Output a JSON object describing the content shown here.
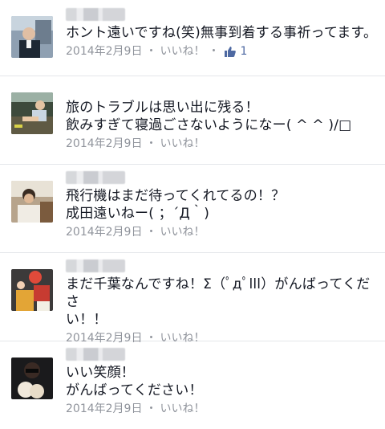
{
  "comments": [
    {
      "text": "ホント遠いですね(笑)無事到着する事祈ってます。",
      "date": "2014年2月9日",
      "like_label": "いいね！",
      "like_count": "1"
    },
    {
      "text": "旅のトラブルは思い出に残る！\n飲みすぎて寝過ごさないようになー( ^ ^ )/□",
      "date": "2014年2月9日",
      "like_label": "いいね！"
    },
    {
      "text": "飛行機はまだ待ってくれてるの！？\n成田遠いねー( ；´Д｀)",
      "date": "2014年2月9日",
      "like_label": "いいね！"
    },
    {
      "text": "まだ千葉なんですね！Σ（ﾟдﾟlll）がんばってくださ\nい！！",
      "date": "2014年2月9日",
      "like_label": "いいね！"
    },
    {
      "text": "いい笑顔！\nがんばってください！",
      "date": "2014年2月9日",
      "like_label": "いいね！"
    }
  ],
  "separator": "・",
  "colors": {
    "meta": "#90949c",
    "like_blue": "#4e69a2"
  }
}
